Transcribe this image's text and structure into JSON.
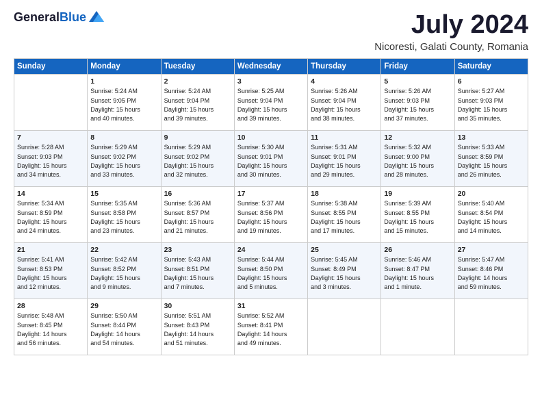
{
  "header": {
    "logo_line1": "General",
    "logo_line2": "Blue",
    "title": "July 2024",
    "subtitle": "Nicoresti, Galati County, Romania"
  },
  "columns": [
    "Sunday",
    "Monday",
    "Tuesday",
    "Wednesday",
    "Thursday",
    "Friday",
    "Saturday"
  ],
  "weeks": [
    [
      {
        "day": "",
        "info": ""
      },
      {
        "day": "1",
        "info": "Sunrise: 5:24 AM\nSunset: 9:05 PM\nDaylight: 15 hours\nand 40 minutes."
      },
      {
        "day": "2",
        "info": "Sunrise: 5:24 AM\nSunset: 9:04 PM\nDaylight: 15 hours\nand 39 minutes."
      },
      {
        "day": "3",
        "info": "Sunrise: 5:25 AM\nSunset: 9:04 PM\nDaylight: 15 hours\nand 39 minutes."
      },
      {
        "day": "4",
        "info": "Sunrise: 5:26 AM\nSunset: 9:04 PM\nDaylight: 15 hours\nand 38 minutes."
      },
      {
        "day": "5",
        "info": "Sunrise: 5:26 AM\nSunset: 9:03 PM\nDaylight: 15 hours\nand 37 minutes."
      },
      {
        "day": "6",
        "info": "Sunrise: 5:27 AM\nSunset: 9:03 PM\nDaylight: 15 hours\nand 35 minutes."
      }
    ],
    [
      {
        "day": "7",
        "info": "Sunrise: 5:28 AM\nSunset: 9:03 PM\nDaylight: 15 hours\nand 34 minutes."
      },
      {
        "day": "8",
        "info": "Sunrise: 5:29 AM\nSunset: 9:02 PM\nDaylight: 15 hours\nand 33 minutes."
      },
      {
        "day": "9",
        "info": "Sunrise: 5:29 AM\nSunset: 9:02 PM\nDaylight: 15 hours\nand 32 minutes."
      },
      {
        "day": "10",
        "info": "Sunrise: 5:30 AM\nSunset: 9:01 PM\nDaylight: 15 hours\nand 30 minutes."
      },
      {
        "day": "11",
        "info": "Sunrise: 5:31 AM\nSunset: 9:01 PM\nDaylight: 15 hours\nand 29 minutes."
      },
      {
        "day": "12",
        "info": "Sunrise: 5:32 AM\nSunset: 9:00 PM\nDaylight: 15 hours\nand 28 minutes."
      },
      {
        "day": "13",
        "info": "Sunrise: 5:33 AM\nSunset: 8:59 PM\nDaylight: 15 hours\nand 26 minutes."
      }
    ],
    [
      {
        "day": "14",
        "info": "Sunrise: 5:34 AM\nSunset: 8:59 PM\nDaylight: 15 hours\nand 24 minutes."
      },
      {
        "day": "15",
        "info": "Sunrise: 5:35 AM\nSunset: 8:58 PM\nDaylight: 15 hours\nand 23 minutes."
      },
      {
        "day": "16",
        "info": "Sunrise: 5:36 AM\nSunset: 8:57 PM\nDaylight: 15 hours\nand 21 minutes."
      },
      {
        "day": "17",
        "info": "Sunrise: 5:37 AM\nSunset: 8:56 PM\nDaylight: 15 hours\nand 19 minutes."
      },
      {
        "day": "18",
        "info": "Sunrise: 5:38 AM\nSunset: 8:55 PM\nDaylight: 15 hours\nand 17 minutes."
      },
      {
        "day": "19",
        "info": "Sunrise: 5:39 AM\nSunset: 8:55 PM\nDaylight: 15 hours\nand 15 minutes."
      },
      {
        "day": "20",
        "info": "Sunrise: 5:40 AM\nSunset: 8:54 PM\nDaylight: 15 hours\nand 14 minutes."
      }
    ],
    [
      {
        "day": "21",
        "info": "Sunrise: 5:41 AM\nSunset: 8:53 PM\nDaylight: 15 hours\nand 12 minutes."
      },
      {
        "day": "22",
        "info": "Sunrise: 5:42 AM\nSunset: 8:52 PM\nDaylight: 15 hours\nand 9 minutes."
      },
      {
        "day": "23",
        "info": "Sunrise: 5:43 AM\nSunset: 8:51 PM\nDaylight: 15 hours\nand 7 minutes."
      },
      {
        "day": "24",
        "info": "Sunrise: 5:44 AM\nSunset: 8:50 PM\nDaylight: 15 hours\nand 5 minutes."
      },
      {
        "day": "25",
        "info": "Sunrise: 5:45 AM\nSunset: 8:49 PM\nDaylight: 15 hours\nand 3 minutes."
      },
      {
        "day": "26",
        "info": "Sunrise: 5:46 AM\nSunset: 8:47 PM\nDaylight: 15 hours\nand 1 minute."
      },
      {
        "day": "27",
        "info": "Sunrise: 5:47 AM\nSunset: 8:46 PM\nDaylight: 14 hours\nand 59 minutes."
      }
    ],
    [
      {
        "day": "28",
        "info": "Sunrise: 5:48 AM\nSunset: 8:45 PM\nDaylight: 14 hours\nand 56 minutes."
      },
      {
        "day": "29",
        "info": "Sunrise: 5:50 AM\nSunset: 8:44 PM\nDaylight: 14 hours\nand 54 minutes."
      },
      {
        "day": "30",
        "info": "Sunrise: 5:51 AM\nSunset: 8:43 PM\nDaylight: 14 hours\nand 51 minutes."
      },
      {
        "day": "31",
        "info": "Sunrise: 5:52 AM\nSunset: 8:41 PM\nDaylight: 14 hours\nand 49 minutes."
      },
      {
        "day": "",
        "info": ""
      },
      {
        "day": "",
        "info": ""
      },
      {
        "day": "",
        "info": ""
      }
    ]
  ]
}
